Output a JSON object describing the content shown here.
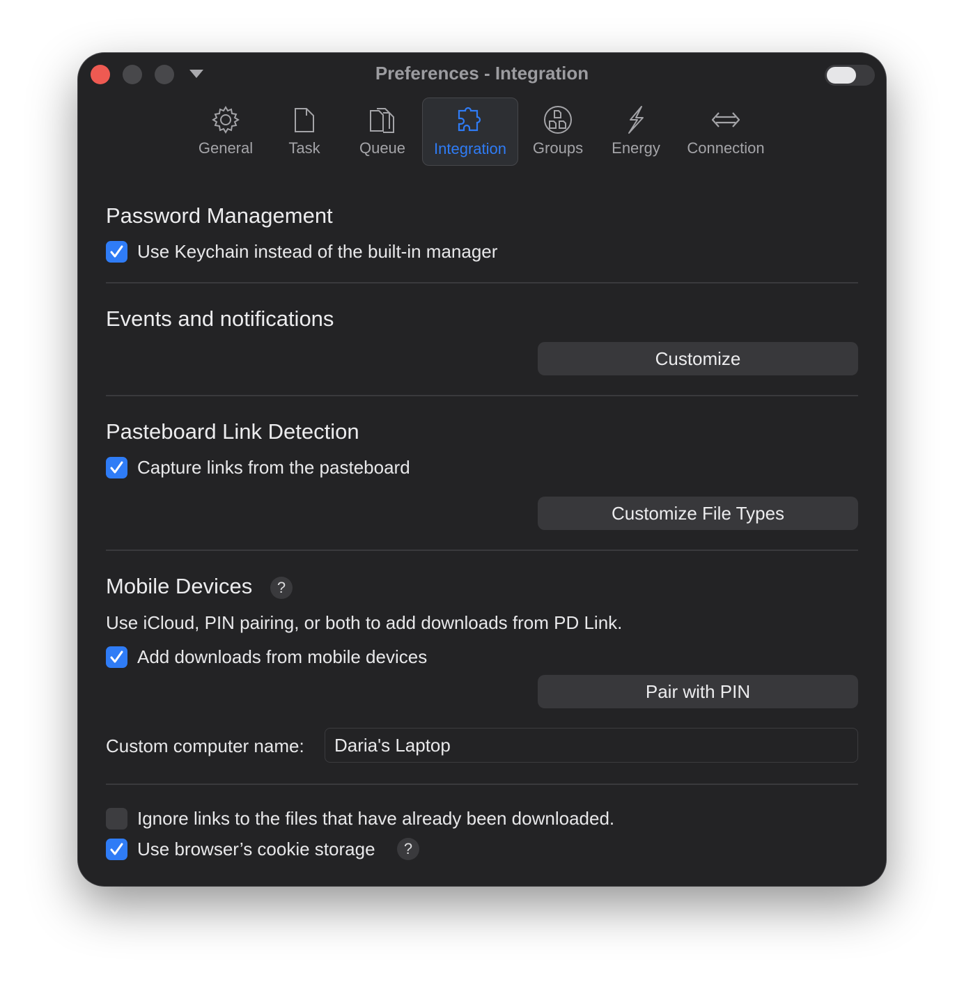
{
  "window": {
    "title": "Preferences - Integration"
  },
  "tabs": [
    {
      "label": "General",
      "icon": "gear-icon"
    },
    {
      "label": "Task",
      "icon": "document-icon"
    },
    {
      "label": "Queue",
      "icon": "stacked-documents-icon"
    },
    {
      "label": "Integration",
      "icon": "puzzle-piece-icon",
      "active": true
    },
    {
      "label": "Groups",
      "icon": "groups-circle-icon"
    },
    {
      "label": "Energy",
      "icon": "lightning-bolt-icon"
    },
    {
      "label": "Connection",
      "icon": "left-right-arrow-icon"
    }
  ],
  "password": {
    "title": "Password Management",
    "keychain_label": "Use Keychain instead of the built-in manager",
    "keychain_checked": true
  },
  "events": {
    "title": "Events and notifications",
    "customize_label": "Customize"
  },
  "pasteboard": {
    "title": "Pasteboard Link Detection",
    "capture_label": "Capture links from the pasteboard",
    "capture_checked": true,
    "customize_types_label": "Customize File Types"
  },
  "mobile": {
    "title": "Mobile Devices",
    "help": "?",
    "description": "Use iCloud, PIN pairing, or both to add downloads from PD Link.",
    "add_label": "Add downloads from mobile devices",
    "add_checked": true,
    "pair_label": "Pair with PIN",
    "computer_name_label": "Custom computer name:",
    "computer_name_value": "Daria's Laptop"
  },
  "misc": {
    "ignore_label": "Ignore links to the files that have already been downloaded.",
    "ignore_checked": false,
    "cookie_label": "Use browser’s cookie storage",
    "cookie_checked": true,
    "cookie_help": "?"
  },
  "colors": {
    "accent": "#2f7cf6",
    "window_bg": "#232325",
    "close": "#ee5a52"
  }
}
